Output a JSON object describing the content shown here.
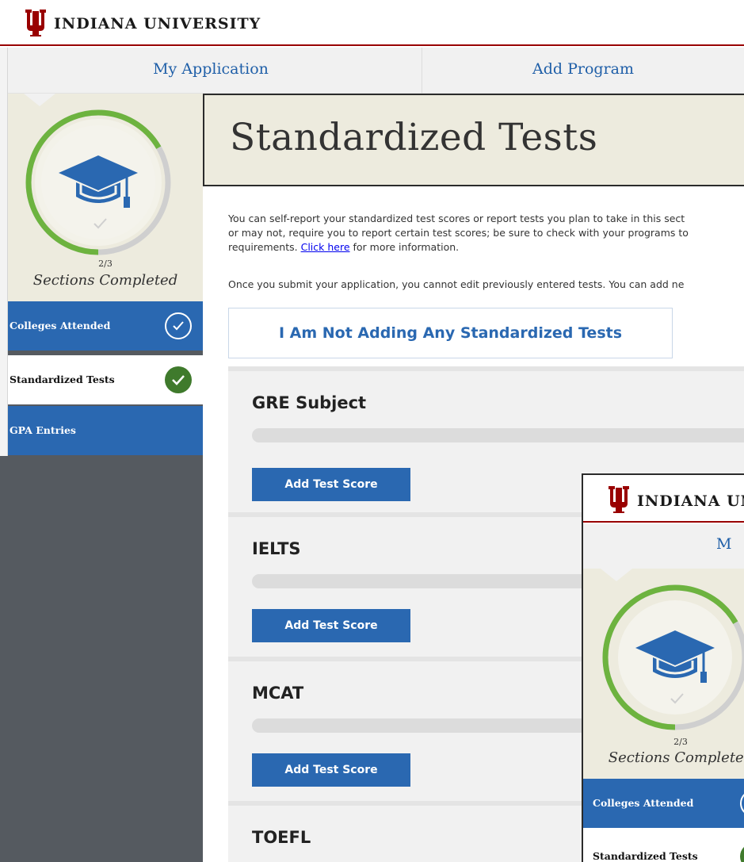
{
  "header": {
    "brand": "INDIANA UNIVERSITY",
    "logo_icon": "iu-trident-logo",
    "brand_color": "#990000"
  },
  "nav": {
    "tabs": [
      {
        "label": "My Application"
      },
      {
        "label": "Add Program"
      }
    ]
  },
  "sidebar": {
    "progress_icon": "graduation-cap-icon",
    "progress_fraction": "2/3",
    "progress_value": 0.6667,
    "progress_label": "Sections Completed",
    "items": [
      {
        "label": "Colleges Attended",
        "status": "complete",
        "icon": "check-circle-outline-icon"
      },
      {
        "label": "Standardized Tests",
        "status": "complete",
        "active": true,
        "icon": "check-circle-filled-icon"
      },
      {
        "label": "GPA Entries",
        "status": "incomplete"
      }
    ]
  },
  "main": {
    "title": "Standardized Tests",
    "intro_line1": "You can self-report your standardized test scores or report tests you plan to take in this sect",
    "intro_line2": "or may not, require you to report certain test scores; be sure to check with your programs to",
    "intro_line3_before": "requirements. ",
    "intro_link": "Click here",
    "intro_line3_after": " for more information.",
    "submit_note": "Once you submit your application, you cannot edit previously entered tests. You can add ne",
    "no_tests_button": "I Am Not Adding Any Standardized Tests",
    "tests": [
      {
        "name": "GRE Subject",
        "button": "Add Test Score"
      },
      {
        "name": "IELTS",
        "button": "Add Test Score"
      },
      {
        "name": "MCAT",
        "button": "Add Test Score"
      },
      {
        "name": "TOEFL"
      }
    ]
  },
  "overlay": {
    "brand": "INDIANA UN",
    "nav_tab": "M",
    "progress_fraction": "2/3",
    "progress_label": "Sections Completed",
    "items": [
      {
        "label": "Colleges Attended"
      },
      {
        "label": "Standardized Tests"
      }
    ]
  },
  "colors": {
    "accent_blue": "#2a68b1",
    "progress_green": "#6db33f",
    "check_green": "#3f7a2c",
    "panel_beige": "#edebde",
    "sidebar_dark": "#555a60"
  }
}
